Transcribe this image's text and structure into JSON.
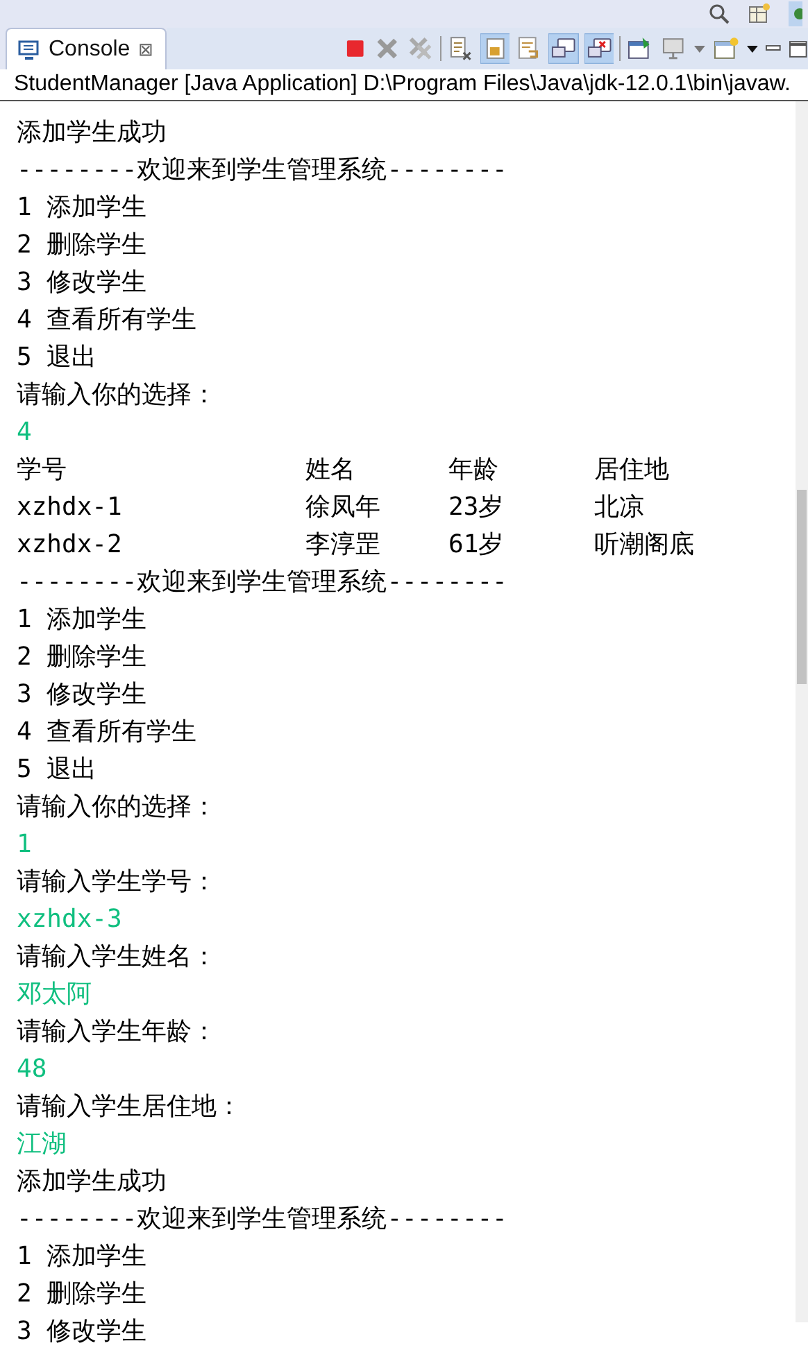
{
  "tab": {
    "label": "Console",
    "close": "⊠",
    "selected": true
  },
  "process": "StudentManager [Java Application] D:\\Program Files\\Java\\jdk-12.0.1\\bin\\javaw.",
  "lines": [
    {
      "kind": "output",
      "text": "添加学生成功"
    },
    {
      "kind": "output",
      "text": "--------欢迎来到学生管理系统--------"
    },
    {
      "kind": "output",
      "text": "1 添加学生"
    },
    {
      "kind": "output",
      "text": "2 删除学生"
    },
    {
      "kind": "output",
      "text": "3 修改学生"
    },
    {
      "kind": "output",
      "text": "4 查看所有学生"
    },
    {
      "kind": "output",
      "text": "5 退出"
    },
    {
      "kind": "output",
      "text": "请输入你的选择："
    },
    {
      "kind": "input",
      "text": "4"
    },
    {
      "kind": "table",
      "cells": [
        "学号",
        "姓名",
        "年龄",
        "居住地"
      ]
    },
    {
      "kind": "table",
      "cells": [
        "xzhdx-1",
        "徐凤年",
        "23岁",
        "北凉"
      ]
    },
    {
      "kind": "table",
      "cells": [
        "xzhdx-2",
        "李淳罡",
        "61岁",
        "听潮阁底"
      ]
    },
    {
      "kind": "output",
      "text": "--------欢迎来到学生管理系统--------"
    },
    {
      "kind": "output",
      "text": "1 添加学生"
    },
    {
      "kind": "output",
      "text": "2 删除学生"
    },
    {
      "kind": "output",
      "text": "3 修改学生"
    },
    {
      "kind": "output",
      "text": "4 查看所有学生"
    },
    {
      "kind": "output",
      "text": "5 退出"
    },
    {
      "kind": "output",
      "text": "请输入你的选择："
    },
    {
      "kind": "input",
      "text": "1"
    },
    {
      "kind": "output",
      "text": "请输入学生学号："
    },
    {
      "kind": "input",
      "text": "xzhdx-3"
    },
    {
      "kind": "output",
      "text": "请输入学生姓名："
    },
    {
      "kind": "input",
      "text": "邓太阿"
    },
    {
      "kind": "output",
      "text": "请输入学生年龄："
    },
    {
      "kind": "input",
      "text": "48"
    },
    {
      "kind": "output",
      "text": "请输入学生居住地："
    },
    {
      "kind": "input",
      "text": "江湖"
    },
    {
      "kind": "output",
      "text": "添加学生成功"
    },
    {
      "kind": "output",
      "text": "--------欢迎来到学生管理系统--------"
    },
    {
      "kind": "output",
      "text": "1 添加学生"
    },
    {
      "kind": "output",
      "text": "2 删除学生"
    },
    {
      "kind": "output",
      "text": "3 修改学生"
    }
  ]
}
